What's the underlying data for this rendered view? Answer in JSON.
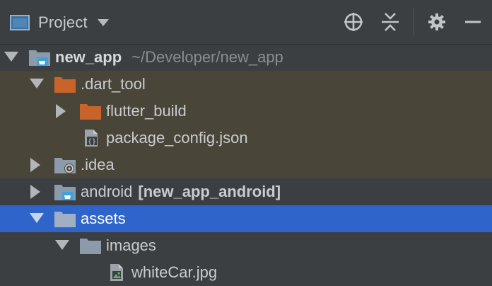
{
  "header": {
    "title": "Project",
    "icons": [
      "project-window-icon",
      "dropdown-caret-icon",
      "locate-icon",
      "collapse-all-icon",
      "settings-gear-icon",
      "hide-minus-icon"
    ]
  },
  "tree": {
    "root": {
      "name": "new_app",
      "path": "~/Developer/new_app"
    },
    "dart_tool": {
      "name": ".dart_tool"
    },
    "flutter_build": {
      "name": "flutter_build"
    },
    "package_config": {
      "name": "package_config.json"
    },
    "idea": {
      "name": ".idea"
    },
    "android": {
      "name": "android",
      "module": "[new_app_android]"
    },
    "assets": {
      "name": "assets"
    },
    "images": {
      "name": "images"
    },
    "whitecar": {
      "name": "whiteCar.jpg"
    }
  },
  "colors": {
    "panel_bg": "#3c3f41",
    "excluded_bg": "#4a4539",
    "selected_bg": "#2f65ca",
    "excluded_folder": "#c8642a",
    "folder": "#8c9bab",
    "module_badge": "#3fa2de"
  }
}
